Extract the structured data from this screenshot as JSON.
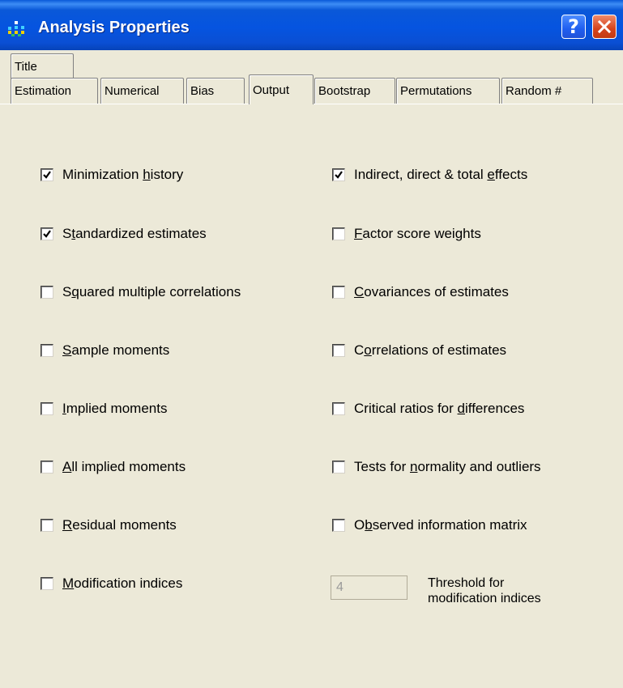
{
  "window": {
    "title": "Analysis Properties"
  },
  "tabs": {
    "title": "Title",
    "estimation": "Estimation",
    "numerical": "Numerical",
    "bias": "Bias",
    "output": "Output",
    "bootstrap": "Bootstrap",
    "permutations": "Permutations",
    "random": "Random #"
  },
  "left_options": [
    {
      "pre": "Minimization ",
      "key": "h",
      "post": "istory",
      "checked": true
    },
    {
      "pre": "S",
      "key": "t",
      "post": "andardized estimates",
      "checked": true
    },
    {
      "pre": "S",
      "key": "q",
      "post": "uared multiple correlations",
      "checked": false
    },
    {
      "pre": "",
      "key": "S",
      "post": "ample moments",
      "checked": false
    },
    {
      "pre": "",
      "key": "I",
      "post": "mplied moments",
      "checked": false
    },
    {
      "pre": "",
      "key": "A",
      "post": "ll implied moments",
      "checked": false
    },
    {
      "pre": "",
      "key": "R",
      "post": "esidual moments",
      "checked": false
    },
    {
      "pre": "",
      "key": "M",
      "post": "odification indices",
      "checked": false
    }
  ],
  "right_options": [
    {
      "pre": "Indirect, direct & total ",
      "key": "e",
      "post": "ffects",
      "checked": true
    },
    {
      "pre": "",
      "key": "F",
      "post": "actor score weights",
      "checked": false
    },
    {
      "pre": "",
      "key": "C",
      "post": "ovariances of estimates",
      "checked": false
    },
    {
      "pre": "C",
      "key": "o",
      "post": "rrelations of estimates",
      "checked": false
    },
    {
      "pre": "Critical ratios for ",
      "key": "d",
      "post": "ifferences",
      "checked": false
    },
    {
      "pre": "Tests for ",
      "key": "n",
      "post": "ormality and outliers",
      "checked": false
    },
    {
      "pre": "O",
      "key": "b",
      "post": "served information matrix",
      "checked": false
    }
  ],
  "threshold": {
    "value": "4",
    "label_line1": "Threshold for",
    "label_line2": "modification indices"
  }
}
